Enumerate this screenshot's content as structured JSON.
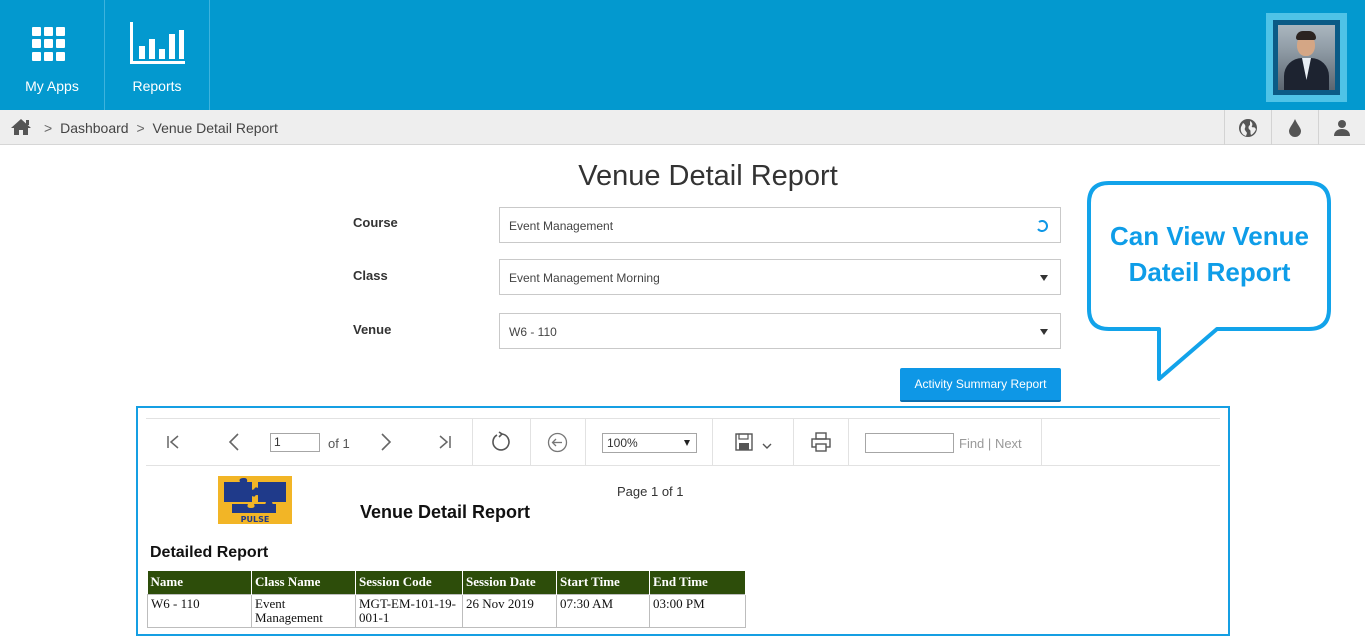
{
  "topbar": {
    "my_apps_label": "My Apps",
    "reports_label": "Reports",
    "bg_color": "#0399cf"
  },
  "breadcrumb": {
    "items": [
      "Dashboard",
      "Venue Detail Report"
    ],
    "separator": ">"
  },
  "page_title": "Venue Detail Report",
  "form": {
    "course": {
      "label": "Course",
      "value": "Event Management"
    },
    "class": {
      "label": "Class",
      "value": "Event Management Morning"
    },
    "venue": {
      "label": "Venue",
      "value": "W6 - 110"
    },
    "summary_button": "Activity Summary Report"
  },
  "callout": {
    "line1": "Can View Venue",
    "line2": "Dateil Report",
    "color": "#0e9de8"
  },
  "viewer": {
    "page_input": "1",
    "of_label": "of 1",
    "zoom": "100%",
    "find_label": "Find",
    "pipe": "|",
    "next_label": "Next",
    "page_count": "Page 1 of 1",
    "report_title": "Venue Detail Report",
    "section_title": "Detailed Report",
    "logo_text": "PULSE",
    "columns": [
      "Name",
      "Class Name",
      "Session Code",
      "Session Date",
      "Start Time",
      "End Time"
    ],
    "rows": [
      [
        "W6 - 110",
        "Event Management",
        "MGT-EM-101-19-001-1",
        "26 Nov 2019",
        "07:30 AM",
        "03:00 PM"
      ]
    ],
    "header_color": "#2d4d0a"
  }
}
